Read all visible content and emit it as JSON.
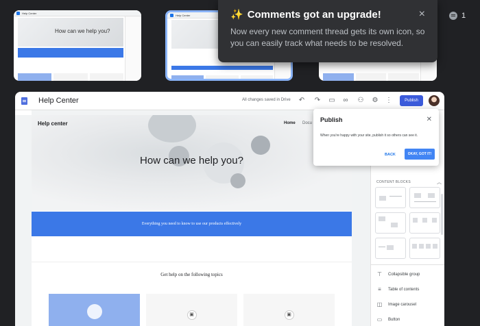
{
  "thumbnails": [
    {
      "title": "Help Center",
      "hero_text": "How can we help you?"
    },
    {
      "title": "Help Center"
    },
    {
      "title": ""
    }
  ],
  "toast": {
    "title": "Comments got an upgrade!",
    "body": "Now every new comment thread gets its own icon, so you can easily track what needs to be resolved.",
    "close_icon": "×"
  },
  "comments": {
    "count": "1"
  },
  "toolbar": {
    "site_name": "Help Center",
    "saved_status": "All changes saved in Drive",
    "publish_label": "Publish"
  },
  "site": {
    "name": "Help center",
    "nav": [
      "Home",
      "Docu"
    ],
    "hero_title": "How can we help you?",
    "band_text": "Everything you need to know to use our products effectively",
    "topics_heading": "Get help on the following topics"
  },
  "panel": {
    "content_blocks_label": "CONTENT BLOCKS",
    "items": [
      {
        "label": "Collapsible group",
        "icon": "collapsible-icon"
      },
      {
        "label": "Table of contents",
        "icon": "toc-icon"
      },
      {
        "label": "Image carousel",
        "icon": "carousel-icon"
      },
      {
        "label": "Button",
        "icon": "button-icon"
      }
    ]
  },
  "publish_popup": {
    "title": "Publish",
    "body": "When you're happy with your site, publish it so others can see it.",
    "back_label": "BACK",
    "ok_label": "OKAY, GOT IT!"
  },
  "colors": {
    "accent": "#3b5bdb",
    "band": "#3b78e7",
    "toast_bg": "#303134"
  }
}
